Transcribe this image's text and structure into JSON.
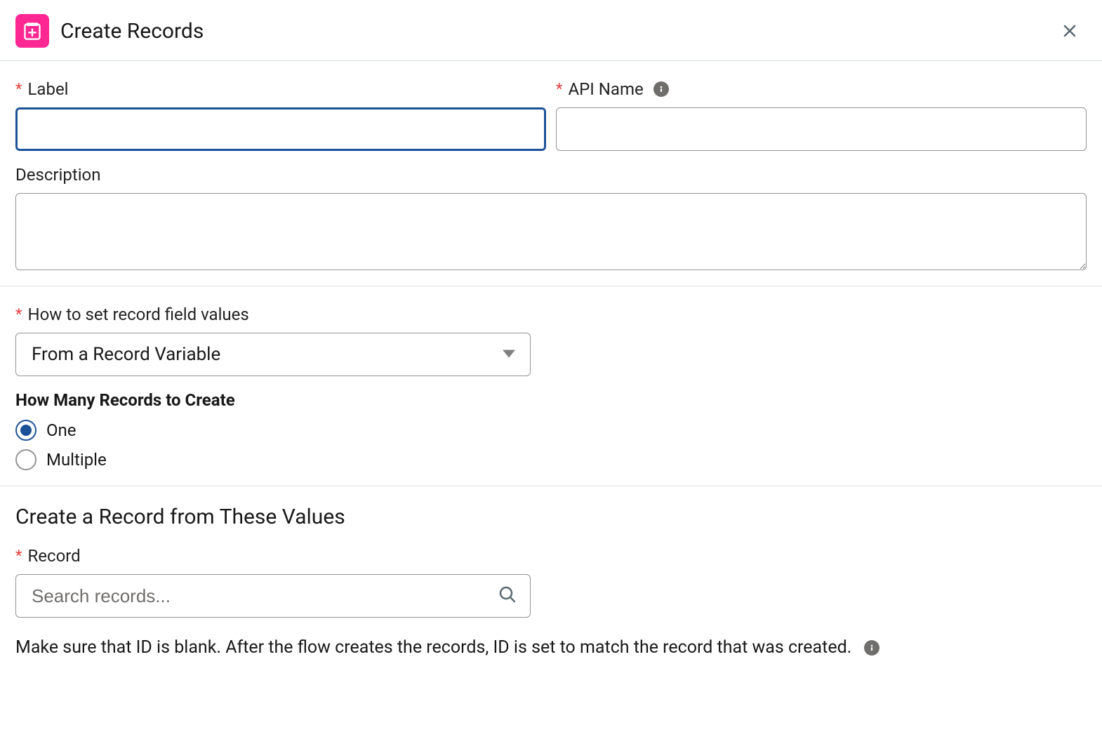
{
  "header": {
    "title": "Create Records"
  },
  "fields": {
    "label": {
      "label": "Label",
      "value": ""
    },
    "apiName": {
      "label": "API Name",
      "value": ""
    },
    "description": {
      "label": "Description",
      "value": ""
    },
    "howToSet": {
      "label": "How to set record field values",
      "selected": "From a Record Variable"
    },
    "howMany": {
      "heading": "How Many Records to Create",
      "options": {
        "one": "One",
        "multiple": "Multiple"
      },
      "selected": "one"
    },
    "record": {
      "label": "Record",
      "placeholder": "Search records..."
    }
  },
  "sections": {
    "createFromValues": "Create a Record from These Values"
  },
  "helpText": "Make sure that ID is blank. After the flow creates the records, ID is set to match the record that was created."
}
